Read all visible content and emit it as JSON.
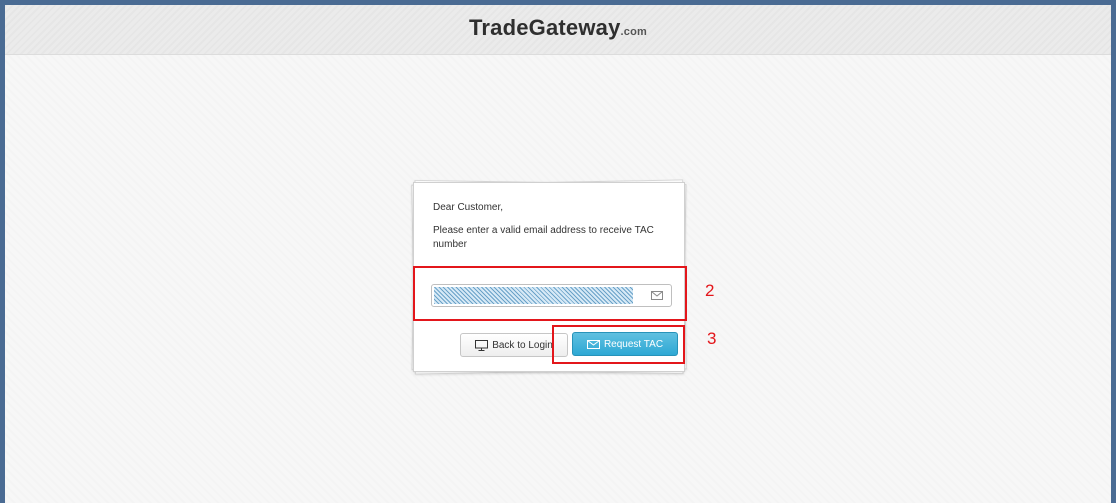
{
  "header": {
    "brand": "TradeGateway",
    "brand_suffix": ".com"
  },
  "card": {
    "greeting": "Dear Customer,",
    "message": "Please enter a valid email address to receive TAC number"
  },
  "email": {
    "value": "",
    "icon": "envelope-icon"
  },
  "buttons": {
    "back_label": "Back to Login",
    "back_icon": "monitor-icon",
    "request_label": "Request TAC",
    "request_icon": "envelope-icon"
  },
  "annotations": {
    "label_2": "2",
    "label_3": "3",
    "color": "#e3161b"
  },
  "colors": {
    "frame": "#4a6b93",
    "primary_button": "#2ea8d4"
  }
}
